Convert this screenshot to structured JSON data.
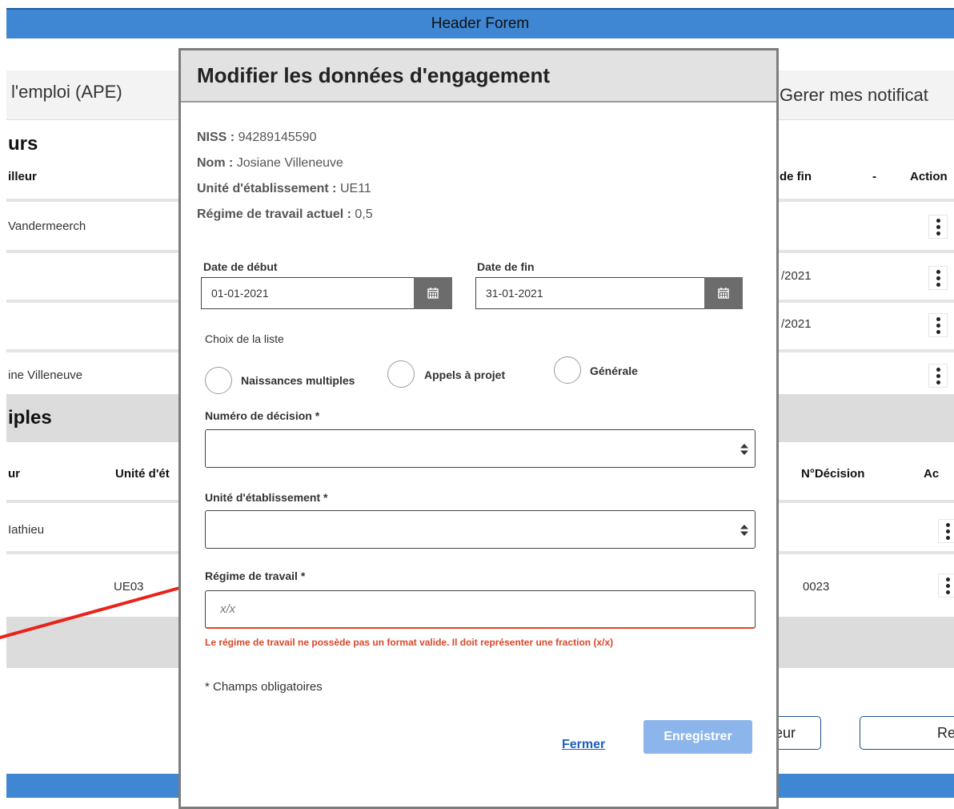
{
  "header": {
    "title": "Header Forem"
  },
  "nav": {
    "left_text": "l'emploi (APE)",
    "right_text": "Gerer mes notificat"
  },
  "bg_section1": {
    "title": "urs",
    "columns": {
      "first": "illeur",
      "date_fin": "de fin",
      "dash": "-",
      "actions": "Action"
    },
    "rows": [
      {
        "name": "Vandermeerch",
        "date": ""
      },
      {
        "name": "",
        "date": "/2021"
      },
      {
        "name": "",
        "date": "/2021"
      },
      {
        "name": "ine Villeneuve",
        "date": ""
      }
    ]
  },
  "bg_section2": {
    "title": "iples",
    "columns": {
      "first": "ur",
      "unite": "Unité d'ét",
      "decision": "N°Décision",
      "actions": "Ac"
    },
    "rows": [
      {
        "name": "Iathieu",
        "unite": "",
        "decision": ""
      },
      {
        "name": "",
        "unite": "UE03",
        "decision": "0023"
      }
    ]
  },
  "bg_buttons": {
    "left": "eur",
    "right": "Re"
  },
  "modal": {
    "title": "Modifier les données d'engagement",
    "info": {
      "niss_label": "NISS :",
      "niss_value": "94289145590",
      "nom_label": "Nom :",
      "nom_value": "Josiane Villeneuve",
      "unite_label": "Unité d'établissement :",
      "unite_value": "UE11",
      "regime_label": "Régime de travail actuel :",
      "regime_value": "0,5"
    },
    "date_debut_label": "Date de début",
    "date_debut_value": "01-01-2021",
    "date_fin_label": "Date de fin",
    "date_fin_value": "31-01-2021",
    "choix_label": "Choix de la liste",
    "radios": [
      "Naissances multiples",
      "Appels à projet",
      "Générale"
    ],
    "decision_label": "Numéro de décision *",
    "decision_value": "",
    "unite_label": "Unité d'établissement *",
    "unite_value": "",
    "regime_label": "Régime de travail *",
    "regime_placeholder": "x/x",
    "regime_error": "Le régime de travail ne possède pas un format valide. Il doit représenter une fraction (x/x)",
    "required_note": "* Champs obligatoires",
    "close_label": "Fermer",
    "save_label": "Enregistrer"
  },
  "colors": {
    "header_blue": "#3f86d3",
    "error_red": "#d9472b",
    "save_disabled": "#8cb6eb",
    "link_blue": "#1f5fc0",
    "annotation_arrow": "#e8231a"
  }
}
